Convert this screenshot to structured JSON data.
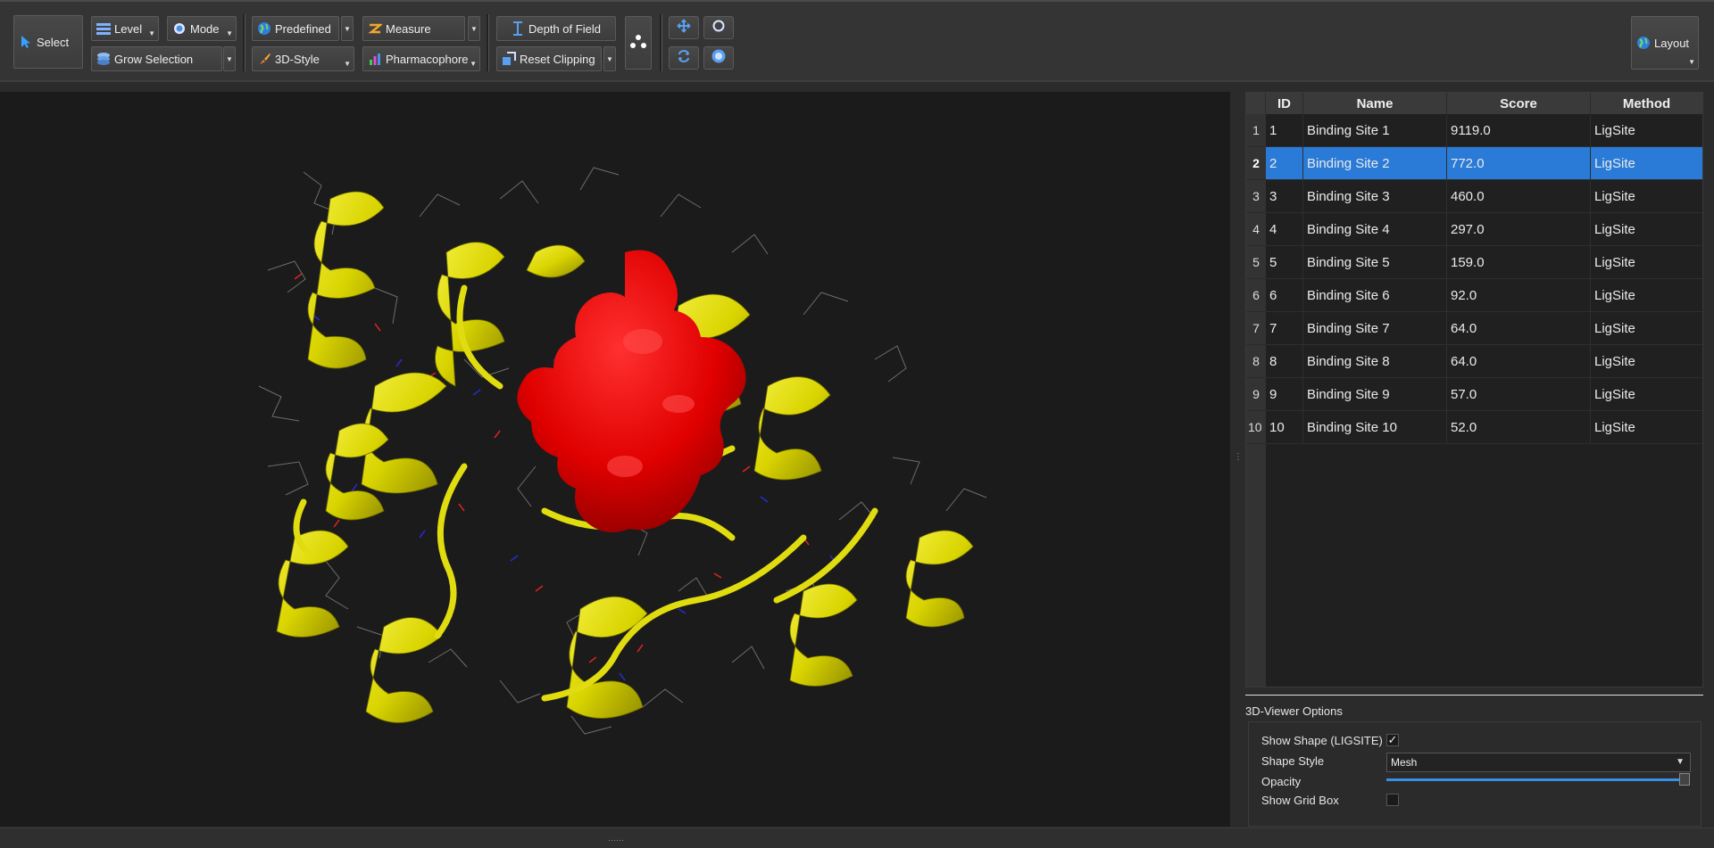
{
  "toolbar": {
    "select_label": "Select",
    "level_label": "Level",
    "mode_label": "Mode",
    "grow_selection_label": "Grow Selection",
    "predefined_label": "Predefined",
    "measure_label": "Measure",
    "style_3d_label": "3D-Style",
    "pharmacophore_label": "Pharmacophore",
    "depth_of_field_label": "Depth of Field",
    "reset_clipping_label": "Reset Clipping",
    "layout_label": "Layout"
  },
  "table": {
    "columns": [
      "ID",
      "Name",
      "Score",
      "Method"
    ],
    "selected_row": 2,
    "rows": [
      {
        "num": "1",
        "id": "1",
        "name": "Binding Site 1",
        "score": "9119.0",
        "method": "LigSite"
      },
      {
        "num": "2",
        "id": "2",
        "name": "Binding Site 2",
        "score": "772.0",
        "method": "LigSite"
      },
      {
        "num": "3",
        "id": "3",
        "name": "Binding Site 3",
        "score": "460.0",
        "method": "LigSite"
      },
      {
        "num": "4",
        "id": "4",
        "name": "Binding Site 4",
        "score": "297.0",
        "method": "LigSite"
      },
      {
        "num": "5",
        "id": "5",
        "name": "Binding Site 5",
        "score": "159.0",
        "method": "LigSite"
      },
      {
        "num": "6",
        "id": "6",
        "name": "Binding Site 6",
        "score": "92.0",
        "method": "LigSite"
      },
      {
        "num": "7",
        "id": "7",
        "name": "Binding Site 7",
        "score": "64.0",
        "method": "LigSite"
      },
      {
        "num": "8",
        "id": "8",
        "name": "Binding Site 8",
        "score": "64.0",
        "method": "LigSite"
      },
      {
        "num": "9",
        "id": "9",
        "name": "Binding Site 9",
        "score": "57.0",
        "method": "LigSite"
      },
      {
        "num": "10",
        "id": "10",
        "name": "Binding Site 10",
        "score": "52.0",
        "method": "LigSite"
      }
    ]
  },
  "options": {
    "title": "3D-Viewer Options",
    "show_shape_label": "Show Shape (LIGSITE)",
    "show_shape_checked": true,
    "shape_style_label": "Shape Style",
    "shape_style_value": "Mesh",
    "opacity_label": "Opacity",
    "opacity_value": 1.0,
    "show_grid_box_label": "Show Grid Box",
    "show_grid_box_checked": false
  },
  "colors": {
    "selection": "#2a7bd7",
    "protein": "#e3e000",
    "pocket": "#e00000",
    "accent": "#3a8ee6"
  }
}
